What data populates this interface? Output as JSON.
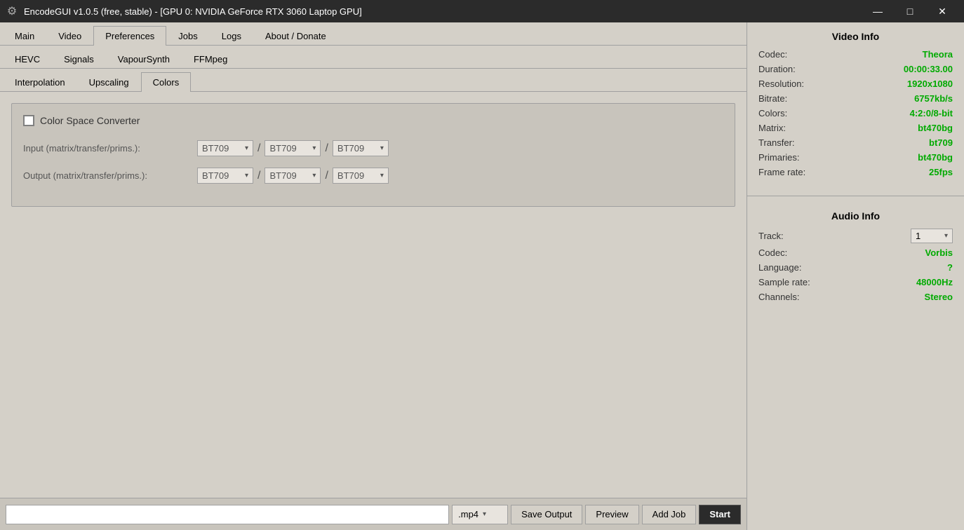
{
  "titleBar": {
    "icon": "⚙",
    "text": "EncodeGUI v1.0.5 (free, stable) - [GPU 0: NVIDIA GeForce RTX 3060 Laptop GPU]",
    "minimizeLabel": "—",
    "restoreLabel": "□",
    "closeLabel": "✕"
  },
  "topNav": {
    "items": [
      {
        "id": "main",
        "label": "Main",
        "active": false
      },
      {
        "id": "video",
        "label": "Video",
        "active": false
      },
      {
        "id": "preferences",
        "label": "Preferences",
        "active": true
      },
      {
        "id": "jobs",
        "label": "Jobs",
        "active": false
      },
      {
        "id": "logs",
        "label": "Logs",
        "active": false
      },
      {
        "id": "about",
        "label": "About / Donate",
        "active": false
      }
    ]
  },
  "subNav1": {
    "items": [
      {
        "id": "hevc",
        "label": "HEVC",
        "active": false
      },
      {
        "id": "signals",
        "label": "Signals",
        "active": false
      },
      {
        "id": "vapoursynth",
        "label": "VapourSynth",
        "active": false
      },
      {
        "id": "ffmpeg",
        "label": "FFMpeg",
        "active": false
      }
    ]
  },
  "subNav2": {
    "items": [
      {
        "id": "interpolation",
        "label": "Interpolation",
        "active": false
      },
      {
        "id": "upscaling",
        "label": "Upscaling",
        "active": false
      },
      {
        "id": "colors",
        "label": "Colors",
        "active": true
      }
    ]
  },
  "colorSpaceConverter": {
    "checkboxLabel": "Color Space Converter",
    "checked": false
  },
  "inputRow": {
    "label": "Input (matrix/transfer/prims.):",
    "matrix": "BT709",
    "transfer": "BT709",
    "prims": "BT709"
  },
  "outputRow": {
    "label": "Output (matrix/transfer/prims.):",
    "matrix": "BT709",
    "transfer": "BT709",
    "prims": "BT709"
  },
  "bottomBar": {
    "outputPath": "",
    "format": ".mp4",
    "saveOutput": "Save Output",
    "preview": "Preview",
    "addJob": "Add Job",
    "start": "Start"
  },
  "videoInfo": {
    "title": "Video Info",
    "rows": [
      {
        "key": "Codec:",
        "value": "Theora"
      },
      {
        "key": "Duration:",
        "value": "00:00:33.00"
      },
      {
        "key": "Resolution:",
        "value": "1920x1080"
      },
      {
        "key": "Bitrate:",
        "value": "6757kb/s"
      },
      {
        "key": "Colors:",
        "value": "4:2:0/8-bit"
      },
      {
        "key": "Matrix:",
        "value": "bt470bg"
      },
      {
        "key": "Transfer:",
        "value": "bt709"
      },
      {
        "key": "Primaries:",
        "value": "bt470bg"
      },
      {
        "key": "Frame rate:",
        "value": "25fps"
      }
    ]
  },
  "audioInfo": {
    "title": "Audio Info",
    "trackLabel": "Track:",
    "trackValue": "1",
    "rows": [
      {
        "key": "Codec:",
        "value": "Vorbis"
      },
      {
        "key": "Language:",
        "value": "?"
      },
      {
        "key": "Sample rate:",
        "value": "48000Hz"
      },
      {
        "key": "Channels:",
        "value": "Stereo"
      }
    ]
  }
}
